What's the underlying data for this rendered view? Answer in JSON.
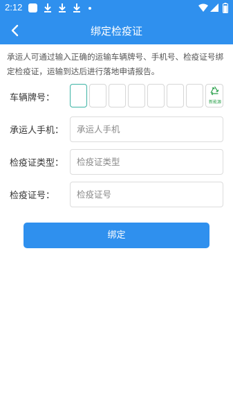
{
  "status_bar": {
    "time": "2:12"
  },
  "header": {
    "title": "绑定检疫证",
    "back_icon": "chevron-left-icon"
  },
  "intro": "承运人可通过输入正确的运输车辆牌号、手机号、检疫证号绑定检疫证，运输到达后进行落地申请报告。",
  "form": {
    "plate_label": "车辆牌号：",
    "plate_cells": [
      "",
      "",
      "",
      "",
      "",
      "",
      ""
    ],
    "new_energy_label": "新能源",
    "phone_label": "承运人手机：",
    "phone_placeholder": "承运人手机",
    "cert_type_label": "检疫证类型：",
    "cert_type_placeholder": "检疫证类型",
    "cert_no_label": "检疫证号：",
    "cert_no_placeholder": "检疫证号"
  },
  "submit_label": "绑定",
  "colors": {
    "primary": "#2f90ee",
    "active_border": "#3bb3a4",
    "new_energy_green": "#2aa04a"
  }
}
